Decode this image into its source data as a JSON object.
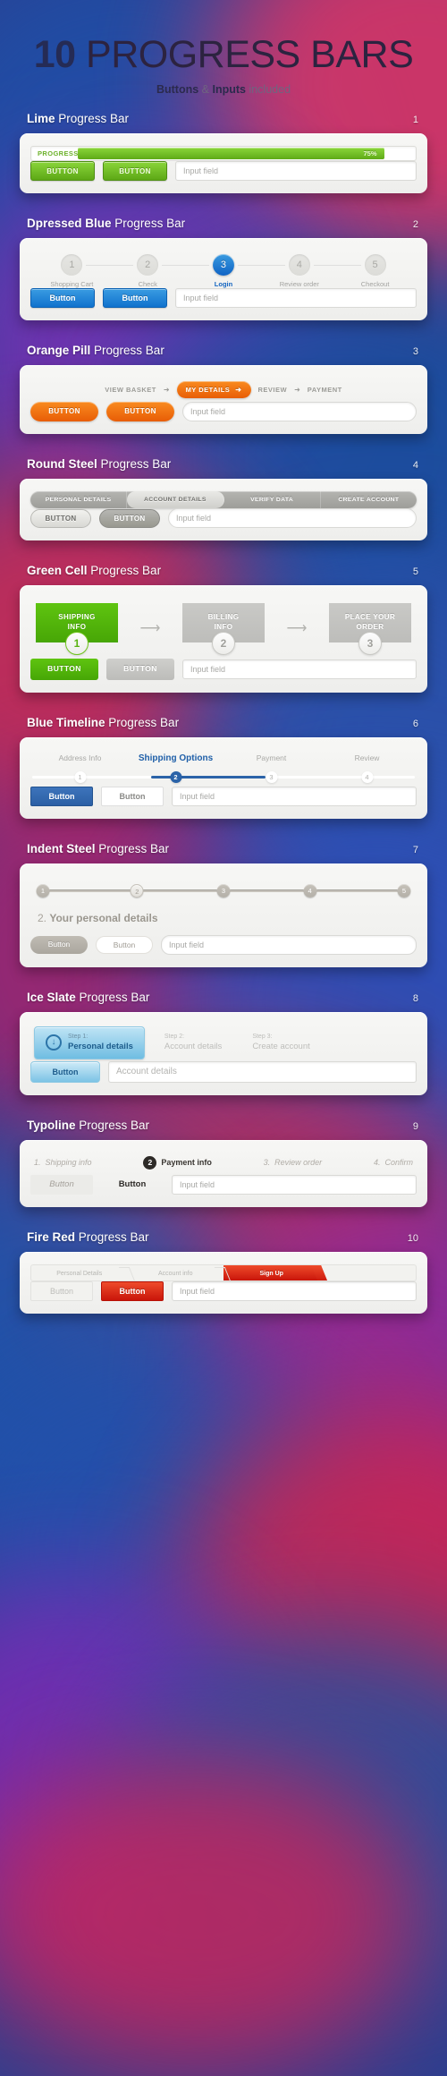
{
  "hero": {
    "title_bold": "10",
    "title_rest": " PROGRESS BARS",
    "sub_bold": "Buttons",
    "sub_amp": " & ",
    "sub_bold2": "Inputs",
    "sub_light": " included"
  },
  "common": {
    "input_placeholder": "Input field"
  },
  "sections": [
    {
      "name_bold": "Lime",
      "name_rest": " Progress Bar",
      "number": "1",
      "progress_label": "PROGRESS",
      "progress_value": "75%",
      "progress_percent": 75,
      "buttons": [
        "BUTTON",
        "BUTTON"
      ],
      "input_placeholder": "Input field"
    },
    {
      "name_bold": "Dpressed Blue",
      "name_rest": " Progress Bar",
      "number": "2",
      "steps": [
        {
          "num": "1",
          "label": "Shopping Cart",
          "active": false
        },
        {
          "num": "2",
          "label": "Check",
          "active": false
        },
        {
          "num": "3",
          "label": "Login",
          "active": true
        },
        {
          "num": "4",
          "label": "Review order",
          "active": false
        },
        {
          "num": "5",
          "label": "Checkout",
          "active": false
        }
      ],
      "buttons": [
        "Button",
        "Button"
      ],
      "input_placeholder": "Input field"
    },
    {
      "name_bold": "Orange Pill",
      "name_rest": " Progress Bar",
      "number": "3",
      "steps": [
        {
          "label": "VIEW BASKET",
          "active": false
        },
        {
          "label": "MY DETAILS",
          "active": true
        },
        {
          "label": "REVIEW",
          "active": false
        },
        {
          "label": "PAYMENT",
          "active": false
        }
      ],
      "arrow": "➜",
      "buttons": [
        "BUTTON",
        "BUTTON"
      ],
      "input_placeholder": "Input field"
    },
    {
      "name_bold": "Round Steel",
      "name_rest": " Progress Bar",
      "number": "4",
      "steps": [
        {
          "label": "PERSONAL DETAILS",
          "active": false
        },
        {
          "label": "ACCOUNT DETAILS",
          "active": true
        },
        {
          "label": "VERIFY DATA",
          "active": false
        },
        {
          "label": "CREATE ACCOUNT",
          "active": false
        }
      ],
      "buttons": [
        "BUTTON",
        "BUTTON"
      ],
      "input_placeholder": "Input field"
    },
    {
      "name_bold": "Green Cell",
      "name_rest": " Progress Bar",
      "number": "5",
      "cells": [
        {
          "line1": "SHIPPING",
          "line2": "INFO",
          "num": "1",
          "active": true
        },
        {
          "line1": "BILLING",
          "line2": "INFO",
          "num": "2",
          "active": false
        },
        {
          "line1": "PLACE YOUR",
          "line2": "ORDER",
          "num": "3",
          "active": false
        }
      ],
      "buttons": [
        "BUTTON",
        "BUTTON"
      ],
      "input_placeholder": "Input field"
    },
    {
      "name_bold": "Blue Timeline",
      "name_rest": " Progress Bar",
      "number": "6",
      "steps": [
        {
          "num": "1",
          "label": "Address Info",
          "active": false
        },
        {
          "num": "2",
          "label": "Shipping Options",
          "active": true
        },
        {
          "num": "3",
          "label": "Payment",
          "active": false
        },
        {
          "num": "4",
          "label": "Review",
          "active": false
        }
      ],
      "buttons": [
        "Button",
        "Button"
      ],
      "input_placeholder": "Input field"
    },
    {
      "name_bold": "Indent Steel",
      "name_rest": " Progress Bar",
      "number": "7",
      "steps": [
        {
          "num": "1",
          "active": false
        },
        {
          "num": "2",
          "active": true
        },
        {
          "num": "3",
          "active": false
        },
        {
          "num": "4",
          "active": false
        },
        {
          "num": "5",
          "active": false
        }
      ],
      "headline_light": "2. ",
      "headline_bold": "Your personal details",
      "buttons": [
        "Button",
        "Button"
      ],
      "input_placeholder": "Input field"
    },
    {
      "name_bold": "Ice Slate",
      "name_rest": " Progress Bar",
      "number": "8",
      "tabs": [
        {
          "top": "Step 1:",
          "bottom": "Personal details",
          "active": true
        },
        {
          "top": "Step 2:",
          "bottom": "Account details",
          "active": false
        },
        {
          "top": "Step 3:",
          "bottom": "Create account",
          "active": false
        }
      ],
      "icon": "↓",
      "buttons": [
        "Button"
      ],
      "input_placeholder": "Account details"
    },
    {
      "name_bold": "Typoline",
      "name_rest": " Progress Bar",
      "number": "9",
      "steps": [
        {
          "num": "1.",
          "label": "Shipping info",
          "active": false
        },
        {
          "num": "2",
          "label": "Payment info",
          "active": true
        },
        {
          "num": "3.",
          "label": "Review order",
          "active": false
        },
        {
          "num": "4.",
          "label": "Confirm",
          "active": false
        }
      ],
      "buttons": [
        "Button",
        "Button"
      ],
      "input_placeholder": "Input field"
    },
    {
      "name_bold": "Fire Red",
      "name_rest": " Progress Bar",
      "number": "10",
      "steps": [
        {
          "label": "Personal Details",
          "active": false
        },
        {
          "label": "Account info",
          "active": false
        },
        {
          "label": "Sign Up",
          "active": true
        }
      ],
      "buttons": [
        "Button",
        "Button"
      ],
      "input_placeholder": "Input field"
    }
  ]
}
